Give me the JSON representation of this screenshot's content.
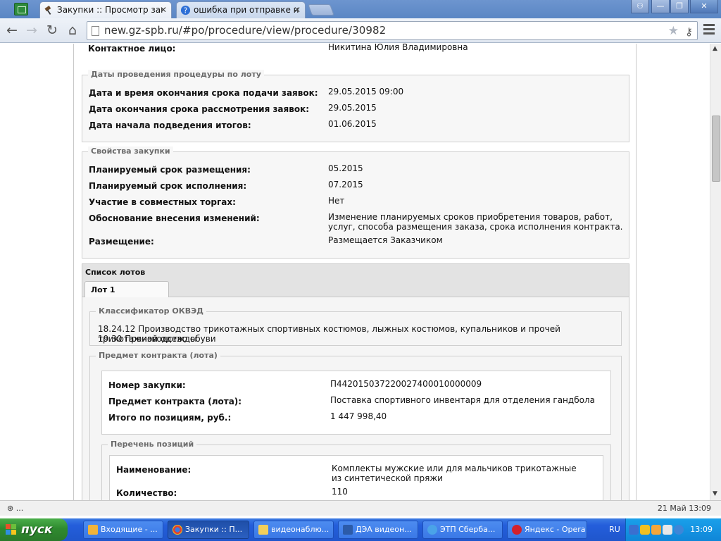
{
  "browser": {
    "tabs": [
      {
        "label": "Закупки :: Просмотр закупки",
        "icon": "gavel-icon"
      },
      {
        "label": "ошибка при отправке на ОО",
        "icon": "help-icon"
      }
    ],
    "url": "new.gz-spb.ru/#po/procedure/view/procedure/30982"
  },
  "page": {
    "contact": {
      "label": "Контактное лицо:",
      "value": "Никитина Юлия Владимировна"
    },
    "dates_section": {
      "legend": "Даты проведения процедуры по лоту",
      "rows": [
        {
          "label": "Дата и время окончания срока подачи заявок:",
          "value": "29.05.2015 09:00"
        },
        {
          "label": "Дата окончания срока рассмотрения заявок:",
          "value": "29.05.2015"
        },
        {
          "label": "Дата начала подведения итогов:",
          "value": "01.06.2015"
        }
      ]
    },
    "props_section": {
      "legend": "Свойства закупки",
      "rows": [
        {
          "label": "Планируемый срок размещения:",
          "value": "05.2015"
        },
        {
          "label": "Планируемый срок исполнения:",
          "value": "07.2015"
        },
        {
          "label": "Участие в совместных торгах:",
          "value": "Нет"
        },
        {
          "label": "Обоснование внесения изменений:",
          "value": "Изменение планируемых сроков приобретения товаров, работ, услуг, способа размещения заказа, срока исполнения контракта."
        },
        {
          "label": "Размещение:",
          "value": "Размещается Заказчиком"
        }
      ]
    },
    "lots": {
      "header": "Список лотов",
      "tab_label": "Лот 1",
      "okved": {
        "legend": "Классификатор ОКВЭД",
        "lines": [
          "18.24.12 Производство трикотажных спортивных костюмов, лыжных костюмов, купальников и прочей трикотажной одежды",
          "19.30 Производство обуви"
        ]
      },
      "subject": {
        "legend": "Предмет контракта (лота)",
        "rows": [
          {
            "label": "Номер закупки:",
            "value": "П442015037220027400010000009"
          },
          {
            "label": "Предмет контракта (лота):",
            "value": "Поставка спортивного инвентаря для отделения гандбола"
          },
          {
            "label": "Итого по позициям, руб.:",
            "value": "1 447 998,40"
          }
        ]
      },
      "positions": {
        "legend": "Перечень позиций",
        "rows": [
          {
            "label": "Наименование:",
            "value": "Комплекты мужские или для мальчиков трикотажные из синтетической пряжи"
          },
          {
            "label": "Количество:",
            "value": "110"
          }
        ]
      }
    }
  },
  "statusbar": {
    "left": "⊛ ...",
    "right": "21 Май 13:09"
  },
  "taskbar": {
    "start": "пуск",
    "items": [
      {
        "label": "Входящие - ...",
        "icon": "mail-icon"
      },
      {
        "label": "Закупки :: П...",
        "icon": "chrome-icon"
      },
      {
        "label": "видеонаблю...",
        "icon": "folder-icon"
      },
      {
        "label": "ДЭА видеон...",
        "icon": "word-icon"
      },
      {
        "label": "ЭТП Сберба...",
        "icon": "ie-icon"
      },
      {
        "label": "Яндекс - Opera",
        "icon": "opera-icon"
      }
    ],
    "lang": "RU",
    "clock": "13:09"
  }
}
